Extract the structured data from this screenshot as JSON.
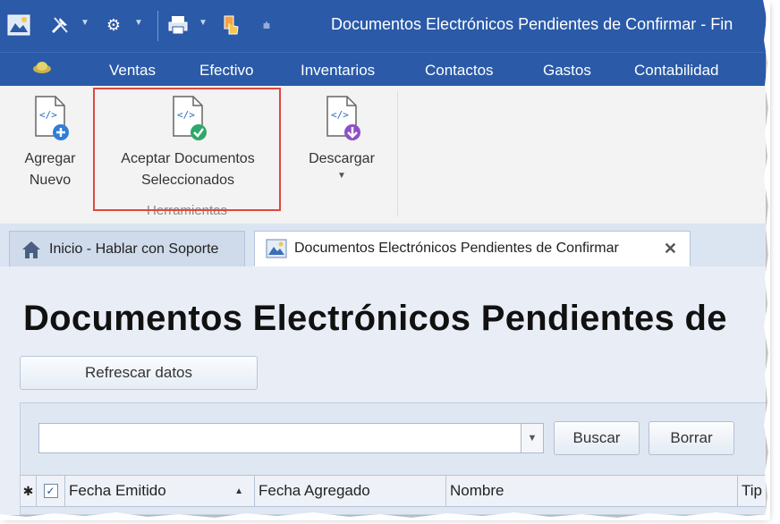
{
  "window": {
    "title": "Documentos Electrónicos Pendientes de Confirmar - Fin"
  },
  "quick_access": {
    "icons": [
      "app-logo-icon",
      "tools-icon",
      "gear-icon",
      "print-icon",
      "touch-icon",
      "customize-icon"
    ]
  },
  "menu": {
    "items": [
      {
        "label": "Ventas"
      },
      {
        "label": "Efectivo"
      },
      {
        "label": "Inventarios"
      },
      {
        "label": "Contactos"
      },
      {
        "label": "Gastos"
      },
      {
        "label": "Contabilidad"
      }
    ]
  },
  "ribbon": {
    "buttons": [
      {
        "label_line1": "Agregar",
        "label_line2": "Nuevo",
        "icon": "xml-add-icon"
      },
      {
        "label_line1": "Aceptar Documentos",
        "label_line2": "Seleccionados",
        "icon": "xml-accept-icon"
      },
      {
        "label_line1": "Descargar",
        "label_line2": "",
        "icon": "xml-download-icon"
      }
    ],
    "group_label": "Herramientas",
    "highlight_color": "#e0473e"
  },
  "tabs": [
    {
      "label": "Inicio - Hablar con Soporte",
      "icon": "home-icon"
    },
    {
      "label": "Documentos Electrónicos Pendientes de Confirmar",
      "icon": "image-icon",
      "active": true
    }
  ],
  "tab_close_glyph": "✕",
  "content": {
    "page_title": "Documentos Electrónicos Pendientes de",
    "refresh_label": "Refrescar datos",
    "search": {
      "value": "",
      "placeholder": ""
    },
    "buscar_label": "Buscar",
    "borrar_label": "Borrar"
  },
  "grid": {
    "new_row_glyph": "✱",
    "columns": [
      {
        "label": "Fecha Emitido",
        "sort": "asc"
      },
      {
        "label": "Fecha Agregado"
      },
      {
        "label": "Nombre"
      },
      {
        "label": "Tip"
      }
    ]
  },
  "colors": {
    "title_bar": "#2a5aa8",
    "ribbon": "#f3f3f3",
    "content_bg": "#e9eef6"
  }
}
